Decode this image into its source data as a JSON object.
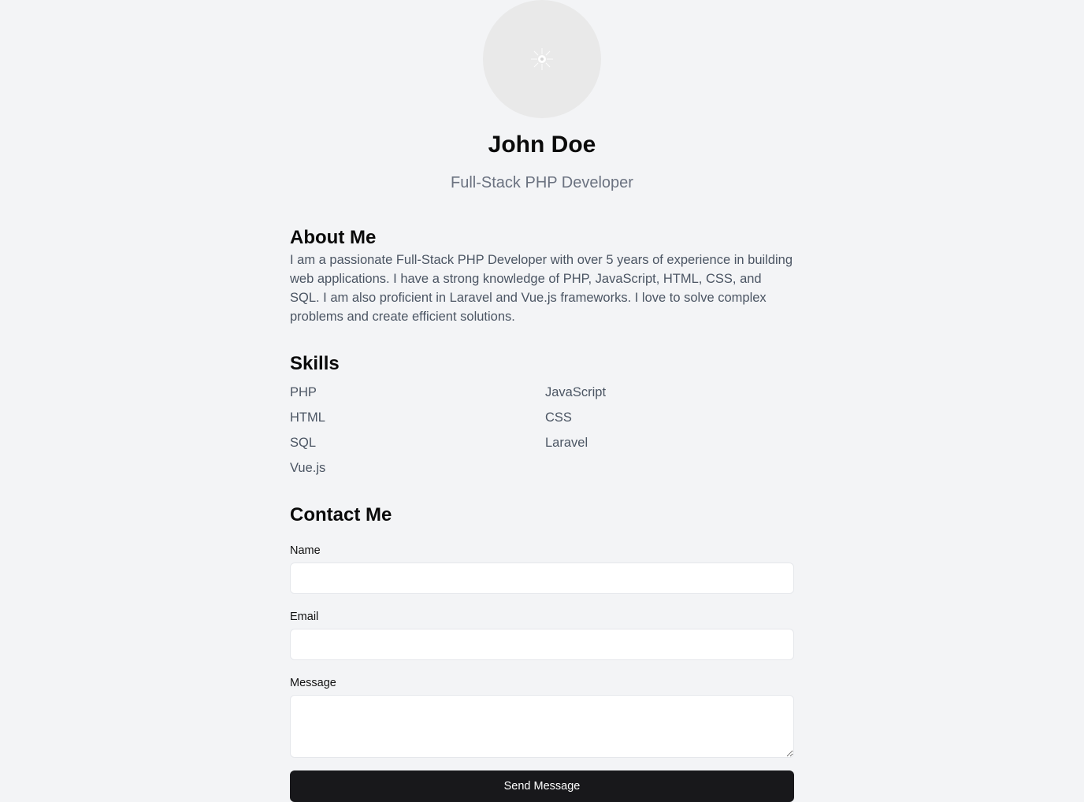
{
  "profile": {
    "avatar_icon": "avatar-image-placeholder-icon",
    "name": "John Doe",
    "role": "Full-Stack PHP Developer"
  },
  "about": {
    "heading": "About Me",
    "text": "I am a passionate Full-Stack PHP Developer with over 5 years of experience in building web applications. I have a strong knowledge of PHP, JavaScript, HTML, CSS, and SQL. I am also proficient in Laravel and Vue.js frameworks. I love to solve complex problems and create efficient solutions."
  },
  "skills": {
    "heading": "Skills",
    "items": [
      "PHP",
      "JavaScript",
      "HTML",
      "CSS",
      "SQL",
      "Laravel",
      "Vue.js"
    ]
  },
  "contact": {
    "heading": "Contact Me",
    "name_label": "Name",
    "name_value": "",
    "email_label": "Email",
    "email_value": "",
    "message_label": "Message",
    "message_value": "",
    "submit_label": "Send Message"
  },
  "colors": {
    "background": "#f3f4f6",
    "heading": "#0a0a0a",
    "muted_text": "#6b7280",
    "body_text": "#4b5563",
    "button": "#18181b"
  }
}
